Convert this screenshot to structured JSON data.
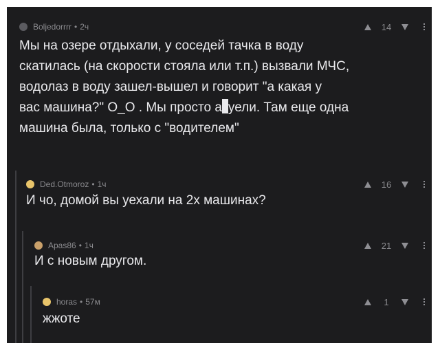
{
  "comments": [
    {
      "author": "Boljedorrrr",
      "time": "2ч",
      "score": "14",
      "avatar_color": "#5b5b60",
      "text_before": "Мы на озере отдыхали, у соседей тачка в воду\nскатилась (на скорости стояла или т.п.) вызвали МЧС,\nводолаз в воду зашел-вышел и говорит \"а какая у\nвас машина?\" О_О . Мы просто а",
      "text_after": "уели. Там еще одна\nмашина была, только с \"водителем\""
    },
    {
      "author": "Ded.Otmoroz",
      "time": "1ч",
      "score": "16",
      "avatar_color": "#e8c46a",
      "text": "И чо, домой вы уехали на 2х машинах?"
    },
    {
      "author": "Apas86",
      "time": "1ч",
      "score": "21",
      "avatar_color": "#c9a06a",
      "text": "И с новым другом."
    },
    {
      "author": "horas",
      "time": "57м",
      "score": "1",
      "avatar_color": "#e8c46a",
      "text": "жжоте"
    }
  ],
  "separator": "•",
  "icons": {
    "upvote": "upvote-icon",
    "downvote": "downvote-icon",
    "more": "more-options-icon"
  }
}
